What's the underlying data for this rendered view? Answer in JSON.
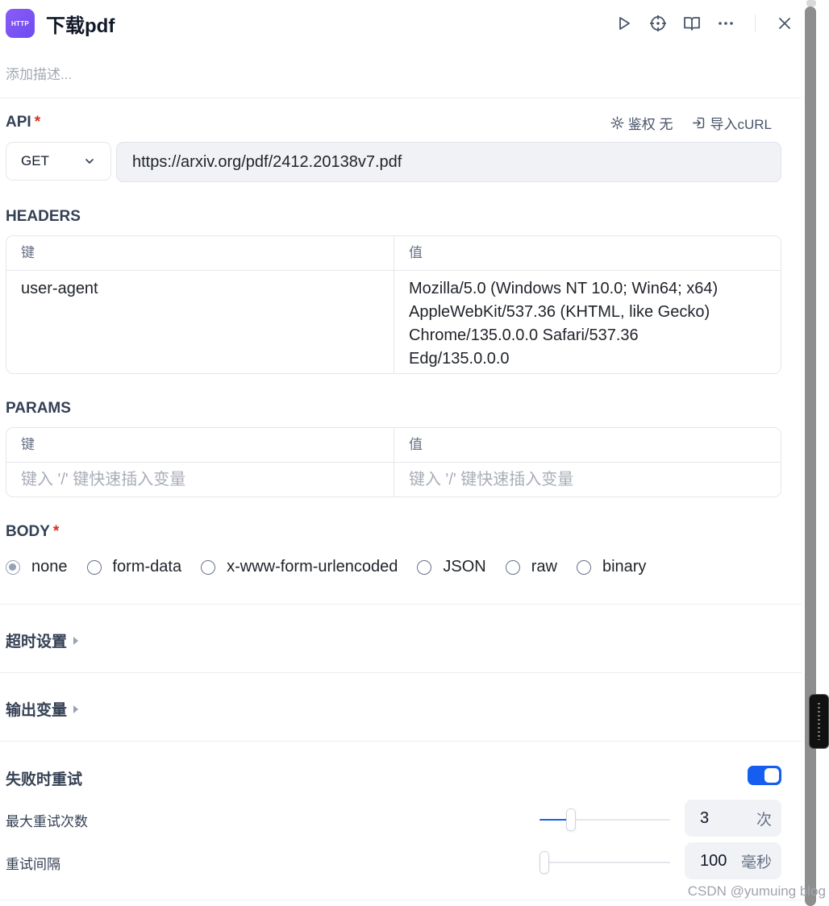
{
  "header": {
    "badge": "HTTP",
    "title": "下载pdf"
  },
  "description_placeholder": "添加描述...",
  "api": {
    "label": "API",
    "required_mark": "*",
    "auth_label": "鉴权 无",
    "import_label": "导入cURL",
    "method": "GET",
    "url": "https://arxiv.org/pdf/2412.20138v7.pdf"
  },
  "headers": {
    "label": "HEADERS",
    "key_header": "键",
    "value_header": "值",
    "rows": [
      {
        "key": "user-agent",
        "value_lines": [
          "Mozilla/5.0 (Windows NT 10.0; Win64; x64)",
          "AppleWebKit/537.36 (KHTML, like Gecko)",
          "Chrome/135.0.0.0 Safari/537.36",
          "Edg/135.0.0.0"
        ]
      }
    ]
  },
  "params": {
    "label": "PARAMS",
    "key_header": "键",
    "value_header": "值",
    "key_placeholder": "键入 '/' 键快速插入变量",
    "value_placeholder": "键入 '/' 键快速插入变量"
  },
  "body": {
    "label": "BODY",
    "required_mark": "*",
    "options": [
      "none",
      "form-data",
      "x-www-form-urlencoded",
      "JSON",
      "raw",
      "binary"
    ],
    "selected": "none"
  },
  "timeout_label": "超时设置",
  "output_label": "输出变量",
  "retry": {
    "label": "失败时重试",
    "enabled": true,
    "max_retries_label": "最大重试次数",
    "max_retries_value": "3",
    "max_retries_unit": "次",
    "max_retries_fraction": 0.24,
    "interval_label": "重试间隔",
    "interval_value": "100",
    "interval_unit": "毫秒",
    "interval_fraction": 0.04
  },
  "watermark": "CSDN @yumuing blog",
  "colors": {
    "accent": "#155eef",
    "badge": "#7c5cf5",
    "required": "#d92d20"
  }
}
